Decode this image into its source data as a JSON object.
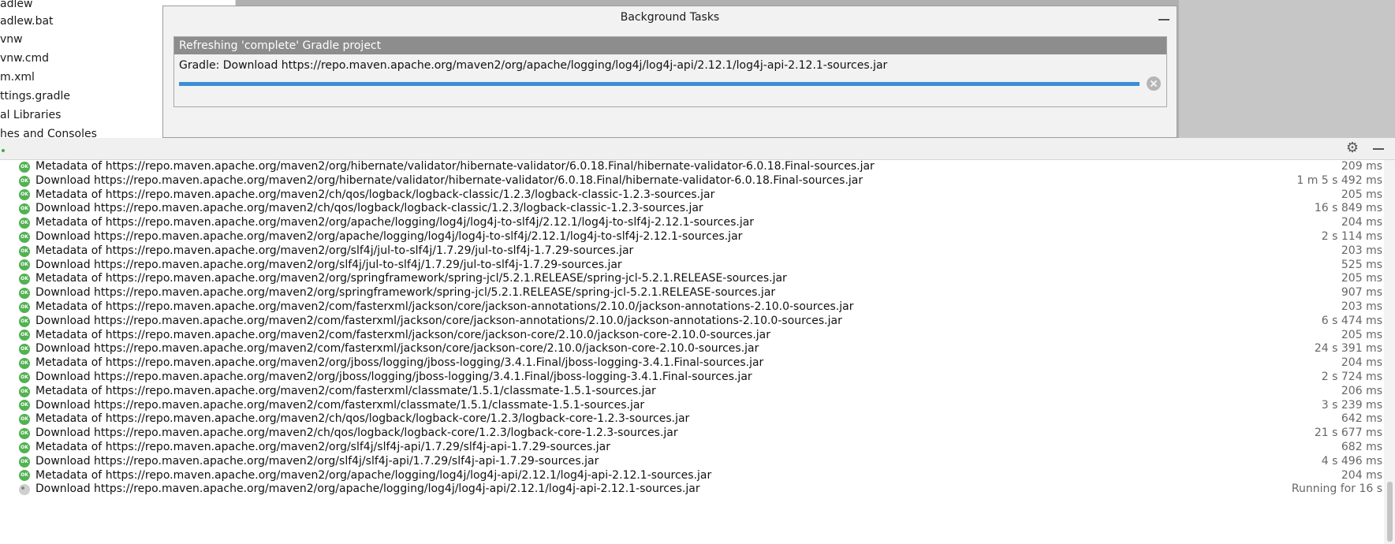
{
  "project_tree": {
    "items": [
      "adlew",
      "adlew.bat",
      "vnw",
      "vnw.cmd",
      "m.xml",
      "ttings.gradle",
      "al Libraries",
      "hes and Consoles"
    ]
  },
  "background_tasks": {
    "title": "Background Tasks",
    "task_header": "Refreshing 'complete' Gradle project",
    "task_text": "Gradle: Download https://repo.maven.apache.org/maven2/org/apache/logging/log4j/log4j-api/2.12.1/log4j-api-2.12.1-sources.jar",
    "progress_percent": 100
  },
  "toolbar": {
    "gear_icon": "gear-icon",
    "minimize_icon": "minimize-icon"
  },
  "log": {
    "status_ok_label": "OK",
    "rows": [
      {
        "status": "ok",
        "text": "Metadata of https://repo.maven.apache.org/maven2/org/hibernate/validator/hibernate-validator/6.0.18.Final/hibernate-validator-6.0.18.Final-sources.jar",
        "time": "209 ms"
      },
      {
        "status": "ok",
        "text": "Download https://repo.maven.apache.org/maven2/org/hibernate/validator/hibernate-validator/6.0.18.Final/hibernate-validator-6.0.18.Final-sources.jar",
        "time": "1 m 5 s 492 ms"
      },
      {
        "status": "ok",
        "text": "Metadata of https://repo.maven.apache.org/maven2/ch/qos/logback/logback-classic/1.2.3/logback-classic-1.2.3-sources.jar",
        "time": "205 ms"
      },
      {
        "status": "ok",
        "text": "Download https://repo.maven.apache.org/maven2/ch/qos/logback/logback-classic/1.2.3/logback-classic-1.2.3-sources.jar",
        "time": "16 s 849 ms"
      },
      {
        "status": "ok",
        "text": "Metadata of https://repo.maven.apache.org/maven2/org/apache/logging/log4j/log4j-to-slf4j/2.12.1/log4j-to-slf4j-2.12.1-sources.jar",
        "time": "204 ms"
      },
      {
        "status": "ok",
        "text": "Download https://repo.maven.apache.org/maven2/org/apache/logging/log4j/log4j-to-slf4j/2.12.1/log4j-to-slf4j-2.12.1-sources.jar",
        "time": "2 s 114 ms"
      },
      {
        "status": "ok",
        "text": "Metadata of https://repo.maven.apache.org/maven2/org/slf4j/jul-to-slf4j/1.7.29/jul-to-slf4j-1.7.29-sources.jar",
        "time": "203 ms"
      },
      {
        "status": "ok",
        "text": "Download https://repo.maven.apache.org/maven2/org/slf4j/jul-to-slf4j/1.7.29/jul-to-slf4j-1.7.29-sources.jar",
        "time": "525 ms"
      },
      {
        "status": "ok",
        "text": "Metadata of https://repo.maven.apache.org/maven2/org/springframework/spring-jcl/5.2.1.RELEASE/spring-jcl-5.2.1.RELEASE-sources.jar",
        "time": "205 ms"
      },
      {
        "status": "ok",
        "text": "Download https://repo.maven.apache.org/maven2/org/springframework/spring-jcl/5.2.1.RELEASE/spring-jcl-5.2.1.RELEASE-sources.jar",
        "time": "907 ms"
      },
      {
        "status": "ok",
        "text": "Metadata of https://repo.maven.apache.org/maven2/com/fasterxml/jackson/core/jackson-annotations/2.10.0/jackson-annotations-2.10.0-sources.jar",
        "time": "203 ms"
      },
      {
        "status": "ok",
        "text": "Download https://repo.maven.apache.org/maven2/com/fasterxml/jackson/core/jackson-annotations/2.10.0/jackson-annotations-2.10.0-sources.jar",
        "time": "6 s 474 ms"
      },
      {
        "status": "ok",
        "text": "Metadata of https://repo.maven.apache.org/maven2/com/fasterxml/jackson/core/jackson-core/2.10.0/jackson-core-2.10.0-sources.jar",
        "time": "205 ms"
      },
      {
        "status": "ok",
        "text": "Download https://repo.maven.apache.org/maven2/com/fasterxml/jackson/core/jackson-core/2.10.0/jackson-core-2.10.0-sources.jar",
        "time": "24 s 391 ms"
      },
      {
        "status": "ok",
        "text": "Metadata of https://repo.maven.apache.org/maven2/org/jboss/logging/jboss-logging/3.4.1.Final/jboss-logging-3.4.1.Final-sources.jar",
        "time": "204 ms"
      },
      {
        "status": "ok",
        "text": "Download https://repo.maven.apache.org/maven2/org/jboss/logging/jboss-logging/3.4.1.Final/jboss-logging-3.4.1.Final-sources.jar",
        "time": "2 s 724 ms"
      },
      {
        "status": "ok",
        "text": "Metadata of https://repo.maven.apache.org/maven2/com/fasterxml/classmate/1.5.1/classmate-1.5.1-sources.jar",
        "time": "206 ms"
      },
      {
        "status": "ok",
        "text": "Download https://repo.maven.apache.org/maven2/com/fasterxml/classmate/1.5.1/classmate-1.5.1-sources.jar",
        "time": "3 s 239 ms"
      },
      {
        "status": "ok",
        "text": "Metadata of https://repo.maven.apache.org/maven2/ch/qos/logback/logback-core/1.2.3/logback-core-1.2.3-sources.jar",
        "time": "642 ms"
      },
      {
        "status": "ok",
        "text": "Download https://repo.maven.apache.org/maven2/ch/qos/logback/logback-core/1.2.3/logback-core-1.2.3-sources.jar",
        "time": "21 s 677 ms"
      },
      {
        "status": "ok",
        "text": "Metadata of https://repo.maven.apache.org/maven2/org/slf4j/slf4j-api/1.7.29/slf4j-api-1.7.29-sources.jar",
        "time": "682 ms"
      },
      {
        "status": "ok",
        "text": "Download https://repo.maven.apache.org/maven2/org/slf4j/slf4j-api/1.7.29/slf4j-api-1.7.29-sources.jar",
        "time": "4 s 496 ms"
      },
      {
        "status": "ok",
        "text": "Metadata of https://repo.maven.apache.org/maven2/org/apache/logging/log4j/log4j-api/2.12.1/log4j-api-2.12.1-sources.jar",
        "time": "204 ms"
      },
      {
        "status": "running",
        "text": "Download https://repo.maven.apache.org/maven2/org/apache/logging/log4j/log4j-api/2.12.1/log4j-api-2.12.1-sources.jar",
        "time": "Running for 16 s"
      }
    ]
  }
}
